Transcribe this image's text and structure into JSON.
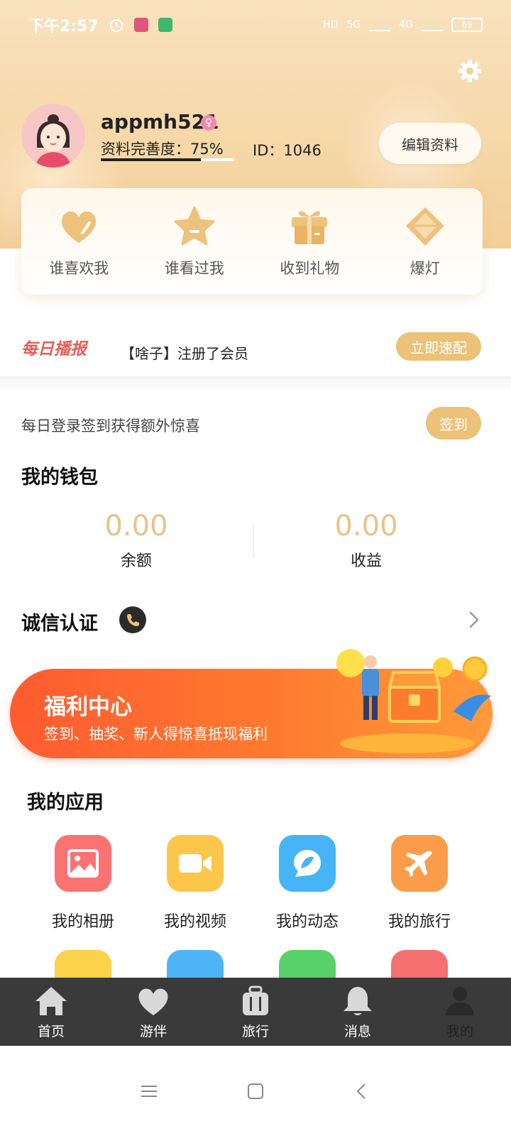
{
  "status_bar": {
    "time": "下午2:57",
    "battery": "69",
    "hd": "HD",
    "net1": "5G",
    "net2": "4G"
  },
  "profile": {
    "username": "appmh521",
    "completion_label": "资料完善度：75%",
    "completion_fraction": 0.75,
    "user_id": "ID：1046",
    "edit_button": "编辑资料"
  },
  "quick_actions": [
    {
      "label": "谁喜欢我",
      "icon": "heart-icon"
    },
    {
      "label": "谁看过我",
      "icon": "star-icon"
    },
    {
      "label": "收到礼物",
      "icon": "gift-icon"
    },
    {
      "label": "爆灯",
      "icon": "diamond-icon"
    }
  ],
  "broadcast": {
    "title": "每日播报",
    "text": "【啥子】注册了会员",
    "button": "立即速配"
  },
  "signin": {
    "text": "每日登录签到获得额外惊喜",
    "button": "签到"
  },
  "wallet": {
    "title": "我的钱包",
    "balance_value": "0.00",
    "balance_label": "余额",
    "income_value": "0.00",
    "income_label": "收益"
  },
  "certification": {
    "title": "诚信认证"
  },
  "welfare": {
    "title": "福利中心",
    "subtitle": "签到、抽奖、新人得惊喜抵现福利"
  },
  "apps": {
    "title": "我的应用",
    "items": [
      {
        "label": "我的相册",
        "icon": "photo-icon",
        "color": "#fb7272"
      },
      {
        "label": "我的视频",
        "icon": "video-icon",
        "color": "#fcc64a"
      },
      {
        "label": "我的动态",
        "icon": "moment-icon",
        "color": "#46b4f6"
      },
      {
        "label": "我的旅行",
        "icon": "plane-icon",
        "color": "#fb9c4a"
      }
    ],
    "row2_colors": [
      "#fcd24a",
      "#4fb4f6",
      "#58d068",
      "#f57070"
    ]
  },
  "bottom_nav": [
    {
      "label": "首页",
      "icon": "home-icon"
    },
    {
      "label": "游伴",
      "icon": "heart-icon"
    },
    {
      "label": "旅行",
      "icon": "luggage-icon"
    },
    {
      "label": "消息",
      "icon": "bell-icon"
    },
    {
      "label": "我的",
      "icon": "person-icon"
    }
  ],
  "colors": {
    "gold": "#ecc178",
    "wallet_value": "#e8c28c",
    "broadcast_red": "#e95d56",
    "welfare_orange": "#ff6a30",
    "nav_bg": "#3a3a3a"
  }
}
